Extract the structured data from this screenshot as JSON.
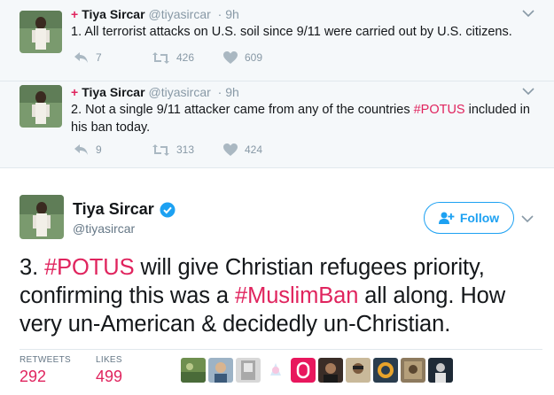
{
  "thread": [
    {
      "name": "Tiya Sircar",
      "handle": "@tiyasircar",
      "time": "· 9h",
      "text_parts": [
        "1. All terrorist attacks on U.S. soil since 9/11 were carried out by U.S. citizens."
      ],
      "replies": "7",
      "retweets": "426",
      "likes": "609"
    },
    {
      "name": "Tiya Sircar",
      "handle": "@tiyasircar",
      "time": "· 9h",
      "text_before": "2. Not a single 9/11 attacker came from any of the countries ",
      "hashtag": "#POTUS",
      "text_after": " included in his ban today.",
      "replies": "9",
      "retweets": "313",
      "likes": "424"
    }
  ],
  "main": {
    "name": "Tiya Sircar",
    "handle": "@tiyasircar",
    "follow_label": "Follow",
    "text_1": "3. ",
    "hashtag_1": "#POTUS",
    "text_2": " will give Christian refugees priority, confirming this was a ",
    "hashtag_2": "#MuslimBan",
    "text_3": " all along. How very un-American & decidedly un-Christian.",
    "retweets_label": "RETWEETS",
    "retweets_value": "292",
    "likes_label": "LIKES",
    "likes_value": "499"
  },
  "colors": {
    "accent": "#1da1f2",
    "hashtag": "#e0245e",
    "thread_bg": "#f5f8fa"
  }
}
